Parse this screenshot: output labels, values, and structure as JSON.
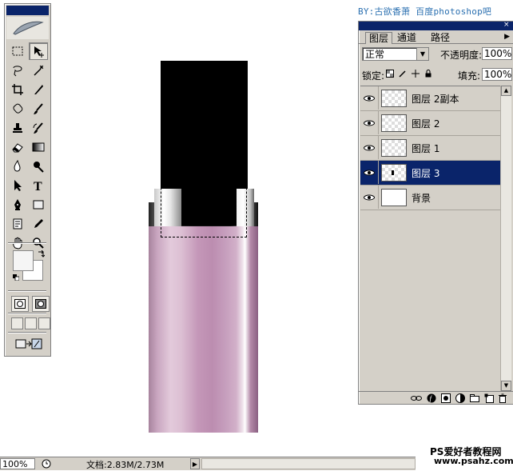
{
  "credit": "BY:古欲香萧  百度photoshop吧",
  "toolbox": {
    "tools": [
      {
        "name": "rectangular-marquee-icon"
      },
      {
        "name": "move-icon",
        "active": true
      },
      {
        "name": "lasso-icon"
      },
      {
        "name": "magic-wand-icon"
      },
      {
        "name": "crop-icon"
      },
      {
        "name": "slice-icon"
      },
      {
        "name": "healing-brush-icon"
      },
      {
        "name": "brush-icon"
      },
      {
        "name": "clone-stamp-icon"
      },
      {
        "name": "history-brush-icon"
      },
      {
        "name": "eraser-icon"
      },
      {
        "name": "gradient-icon"
      },
      {
        "name": "blur-icon"
      },
      {
        "name": "dodge-icon"
      },
      {
        "name": "path-selection-icon"
      },
      {
        "name": "type-icon",
        "glyph": "T"
      },
      {
        "name": "pen-icon"
      },
      {
        "name": "shape-icon"
      },
      {
        "name": "notes-icon"
      },
      {
        "name": "eyedropper-icon"
      },
      {
        "name": "hand-icon"
      },
      {
        "name": "zoom-icon"
      }
    ],
    "foreground_color": "#f5f5f5",
    "background_color": "#ffffff"
  },
  "layers_panel": {
    "tabs": [
      "图层",
      "通道",
      "路径"
    ],
    "blend_mode": "正常",
    "opacity_label": "不透明度:",
    "opacity_value": "100%",
    "lock_label": "锁定:",
    "fill_label": "填充:",
    "fill_value": "100%",
    "layers": [
      {
        "name": "图层 2副本",
        "selected": false,
        "thumb": "transparent"
      },
      {
        "name": "图层 2",
        "selected": false,
        "thumb": "transparent"
      },
      {
        "name": "图层 1",
        "selected": false,
        "thumb": "transparent"
      },
      {
        "name": "图层 3",
        "selected": true,
        "thumb": "transparent-dot"
      },
      {
        "name": "背景",
        "selected": false,
        "thumb": "white"
      }
    ],
    "selection_color": "#0a246a"
  },
  "status_bar": {
    "zoom": "100%",
    "doc_info": "文档:2.83M/2.73M"
  },
  "watermark": {
    "line1": "PS爱好者教程网",
    "line2": "www.psahz.com"
  }
}
